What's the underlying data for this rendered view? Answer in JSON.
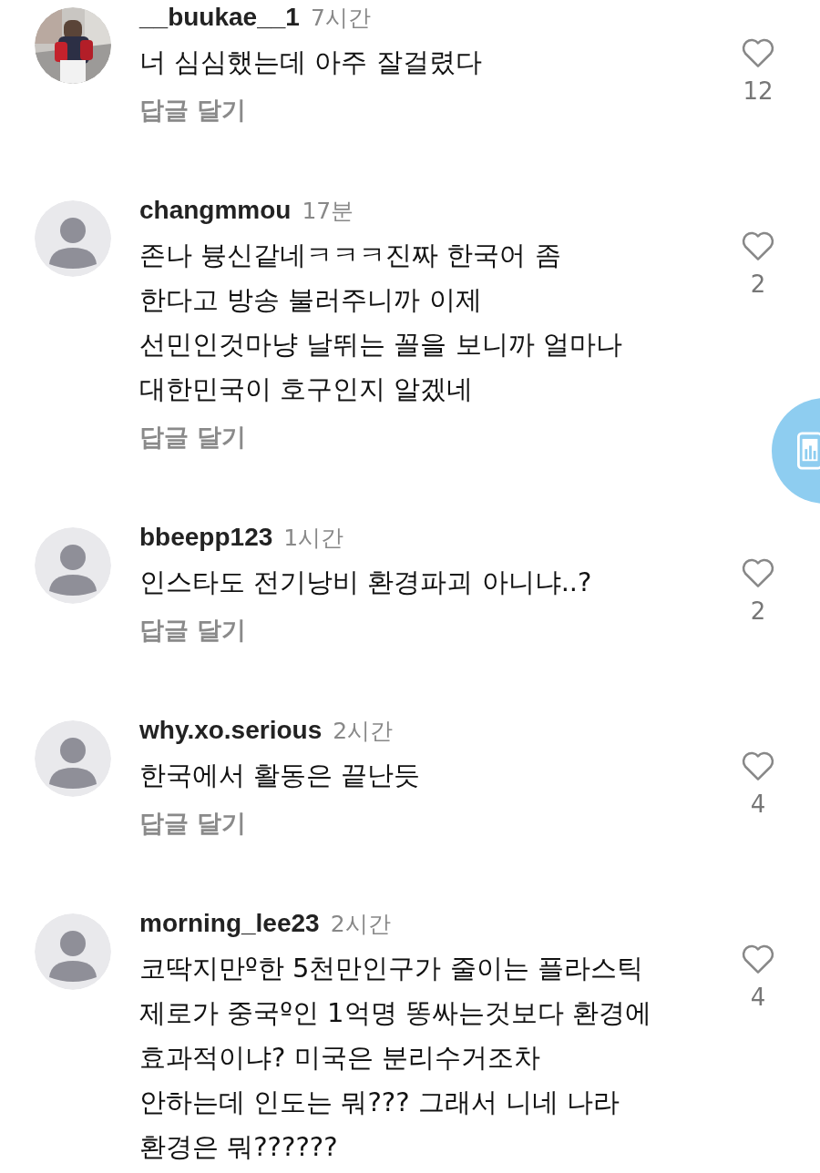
{
  "comments": [
    {
      "username": "__buukae__1",
      "time": "7시간",
      "lines": [
        "너 심심했는데 아주 잘걸렸다"
      ],
      "reply": "답글 달기",
      "likes": "12"
    },
    {
      "avatar": {
        "kind": "default"
      },
      "username": "changmmou",
      "time": "17분",
      "lines": [
        "존나 븅신같네ㅋㅋㅋ진짜 한국어 좀",
        "한다고 방송 불러주니까 이제",
        "선민인것마냥 날뛰는 꼴을 보니까 얼마나",
        "대한민국이 호구인지 알겠네"
      ],
      "reply": "답글 달기",
      "likes": "2"
    },
    {
      "avatar": {
        "kind": "default"
      },
      "username": "bbeepp123",
      "time": "1시간",
      "lines": [
        "인스타도 전기낭비 환경파괴 아니냐..?"
      ],
      "reply": "답글 달기",
      "likes": "2"
    },
    {
      "avatar": {
        "kind": "default"
      },
      "username": "why.xo.serious",
      "time": "2시간",
      "lines": [
        "한국에서 활동은 끝난듯"
      ],
      "reply": "답글 달기",
      "likes": "4"
    },
    {
      "avatar": {
        "kind": "default"
      },
      "username": "morning_lee23",
      "time": "2시간",
      "lines": [
        "코딱지만º한 5천만인구가 줄이는 플라스틱",
        "제로가 중국º인 1억명 똥싸는것보다 환경에",
        "효과적이냐? 미국은 분리수거조차",
        "안하는데 인도는 뭐??? 그래서 니네 나라",
        "환경은 뭐??????"
      ],
      "likes": "4"
    }
  ]
}
